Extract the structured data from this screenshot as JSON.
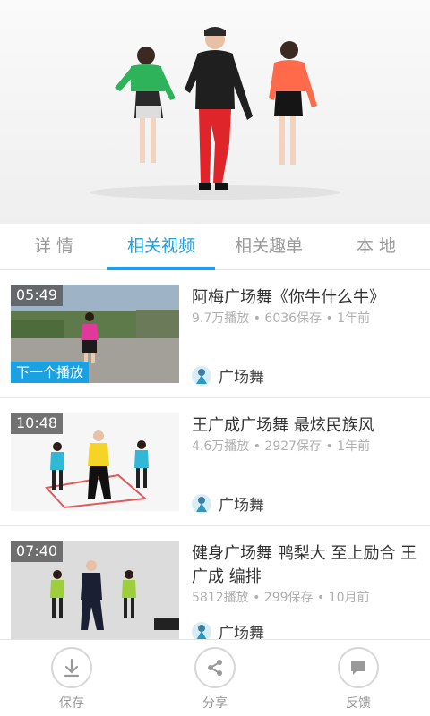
{
  "tabs": [
    {
      "label": "详 情"
    },
    {
      "label": "相关视频"
    },
    {
      "label": "相关趣单"
    },
    {
      "label": "本 地"
    }
  ],
  "active_tab": 1,
  "videos": [
    {
      "duration": "05:49",
      "badge": "下一个播放",
      "title": "阿梅广场舞《你牛什么牛》",
      "meta": "9.7万播放 • 6036保存 • 1年前",
      "author": "广场舞"
    },
    {
      "duration": "10:48",
      "title": "王广成广场舞 最炫民族风",
      "meta": "4.6万播放 • 2927保存 • 1年前",
      "author": "广场舞"
    },
    {
      "duration": "07:40",
      "title": "健身广场舞 鸭梨大 至上励合 王广成 编排",
      "meta": "5812播放 • 299保存 • 10月前",
      "author": "广场舞"
    }
  ],
  "bottom_bar": [
    {
      "label": "保存",
      "icon": "download-icon"
    },
    {
      "label": "分享",
      "icon": "share-icon"
    },
    {
      "label": "反馈",
      "icon": "feedback-icon"
    }
  ],
  "colors": {
    "accent": "#1ba0e1"
  }
}
